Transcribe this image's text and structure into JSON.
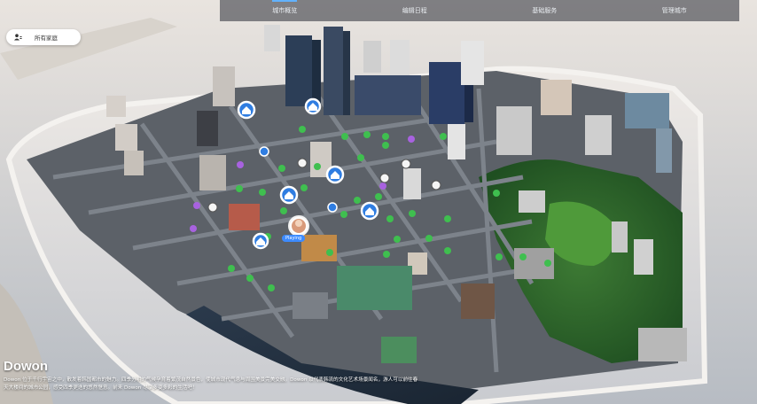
{
  "nav": {
    "tabs": [
      {
        "label": "城市概览",
        "active": true
      },
      {
        "label": "编辑日程",
        "active": false
      },
      {
        "label": "基础服务",
        "active": false
      },
      {
        "label": "管理城市",
        "active": false
      }
    ]
  },
  "home_button": {
    "label": "所有家庭"
  },
  "city": {
    "name": "Dowon",
    "description": "Dowon 位于千行宇宙之中，散发着韩国都市的魅力。四季分明的气候孕育着繁茂自然景色，使城市现代气息与周围美景完美交融。Dowon 以代表韩流的文化艺术场景闻名，游人可以前往春天大楼间的城市公园，感受四季更迭的悠然惬意。前来 Dowon 尽享多姿多彩的生活吧！"
  },
  "map": {
    "pin_label": "Playing"
  },
  "colors": {
    "pin_green": "#3fbf4f",
    "pin_purple": "#a862e0",
    "pin_blue": "#2f7de1",
    "nav_active": "#62b2ff"
  }
}
